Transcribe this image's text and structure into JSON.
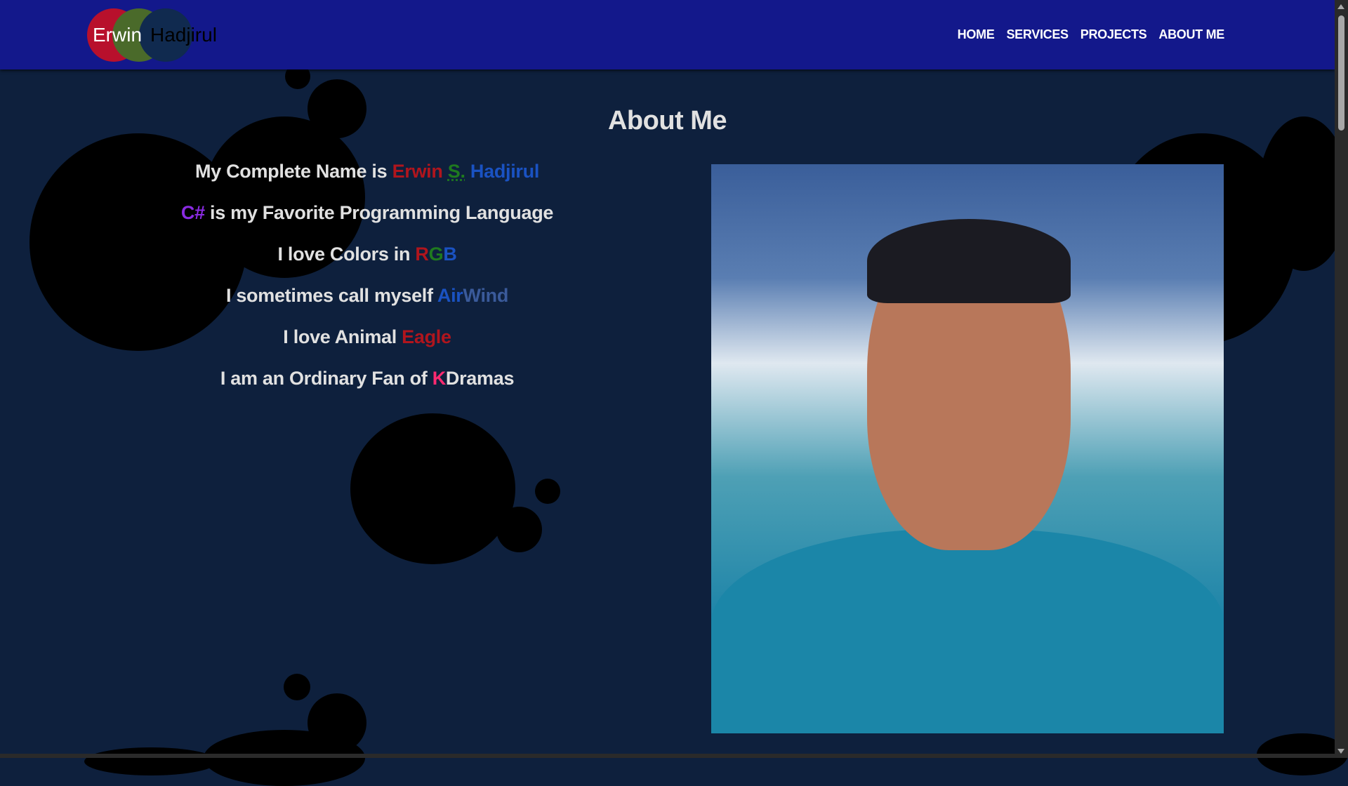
{
  "logo": {
    "first": "Erwin",
    "last": "Hadjirul"
  },
  "nav": {
    "items": [
      "HOME",
      "SERVICES",
      "PROJECTS",
      "ABOUT ME"
    ]
  },
  "page": {
    "title": "About Me"
  },
  "facts": {
    "f1": {
      "text": "My Complete Name is ",
      "hl1": "Erwin",
      "hl2": "S.",
      "hl3": "Hadjirul"
    },
    "f2": {
      "hl": "C#",
      "text": " is my Favorite Programming Language"
    },
    "f3": {
      "text": "I love Colors in ",
      "r": "R",
      "g": "G",
      "b": "B"
    },
    "f4": {
      "text": "I sometimes call myself ",
      "hl1": "Air",
      "hl2": "Wind"
    },
    "f5": {
      "text": "I love Animal ",
      "hl": "Eagle"
    },
    "f6": {
      "text": "I am an Ordinary Fan of ",
      "hl": "K",
      "rest": "Dramas"
    }
  },
  "colors": {
    "navbar": "#13188b",
    "background": "#0e203d",
    "text": "#e1e1e1"
  },
  "icons": {
    "photo": "profile-photo"
  }
}
